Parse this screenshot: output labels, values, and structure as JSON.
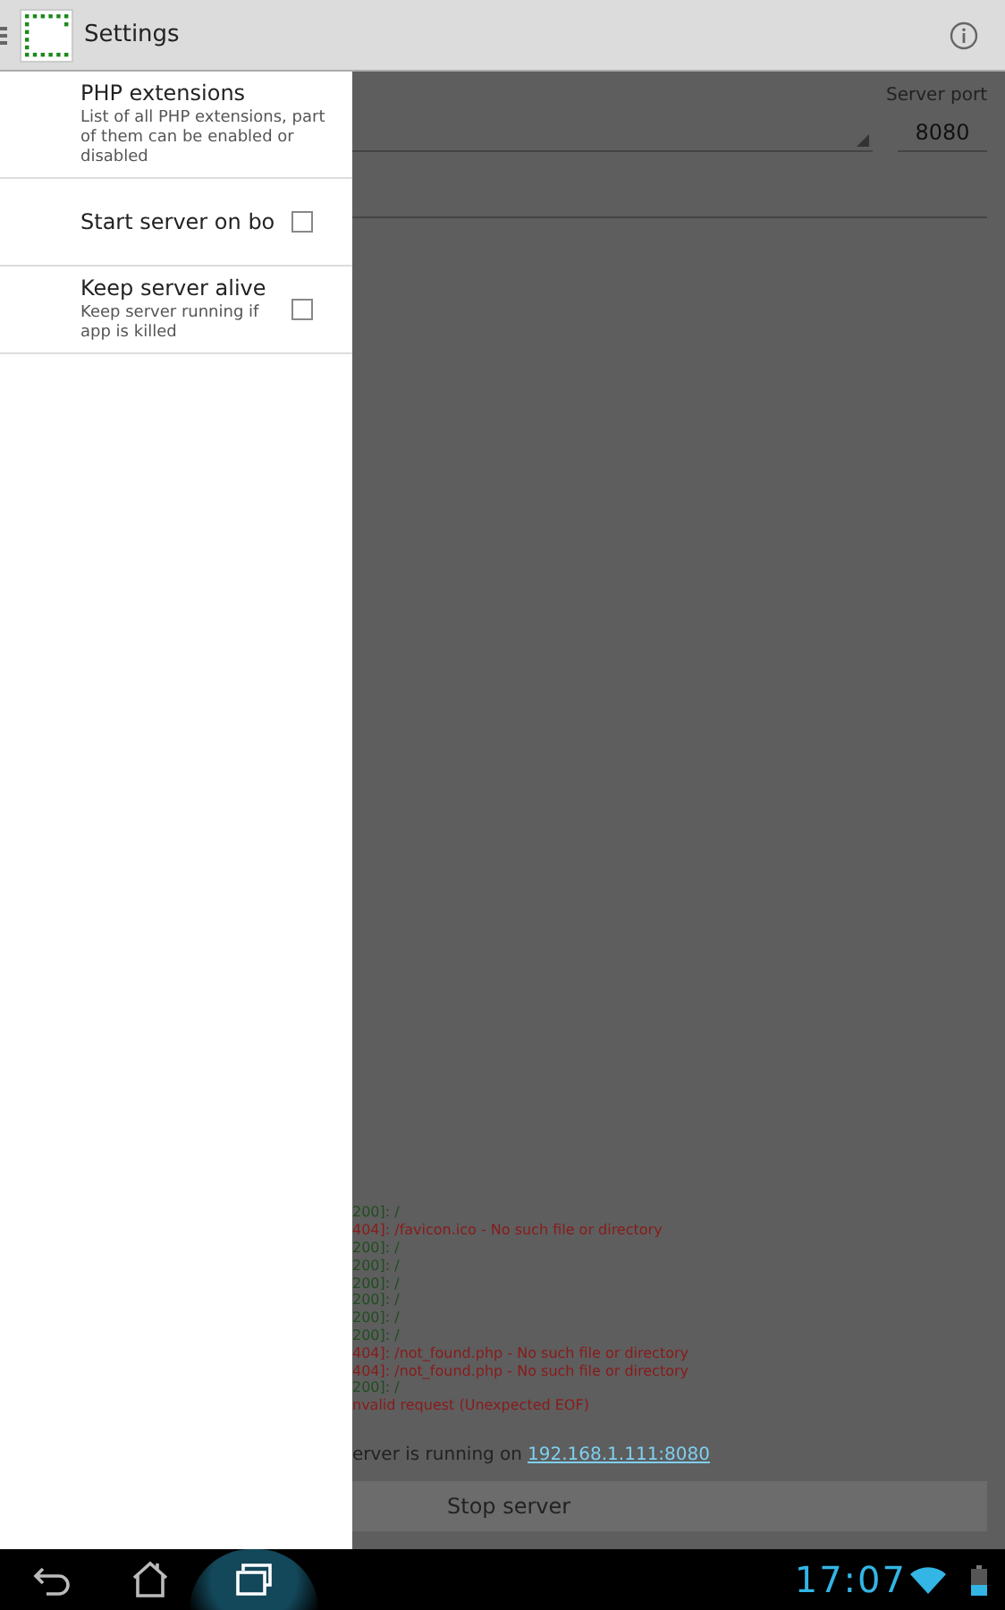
{
  "action_bar": {
    "title": "Settings"
  },
  "drawer": {
    "items": [
      {
        "kind": "link",
        "title": "PHP extensions",
        "summary": "List of all PHP extensions, part of them can be enabled or disabled"
      },
      {
        "kind": "checkbox",
        "title": "Start server on bo",
        "checked": false
      },
      {
        "kind": "checkbox",
        "title": "Keep server alive",
        "summary": "Keep server running if app is killed",
        "checked": false
      }
    ]
  },
  "main": {
    "port_label": "Server port",
    "port_value": "8080",
    "log": [
      {
        "kind": "ok",
        "text": "200]: /"
      },
      {
        "kind": "error",
        "text": "404]: /favicon.ico - No such file or directory"
      },
      {
        "kind": "ok",
        "text": "200]: /"
      },
      {
        "kind": "ok",
        "text": "200]: /"
      },
      {
        "kind": "ok",
        "text": "200]: /"
      },
      {
        "kind": "ok",
        "text": "200]: /"
      },
      {
        "kind": "ok",
        "text": "200]: /"
      },
      {
        "kind": "ok",
        "text": "200]: /"
      },
      {
        "kind": "error",
        "text": "404]: /not_found.php - No such file or directory"
      },
      {
        "kind": "error",
        "text": "404]: /not_found.php - No such file or directory"
      },
      {
        "kind": "ok",
        "text": "200]: /"
      },
      {
        "kind": "error",
        "text": "nvalid request (Unexpected EOF)"
      }
    ],
    "status_text": "erver is running on",
    "status_link": "192.168.1.111:8080",
    "button": "Stop server"
  },
  "nav_bar": {
    "time": "17:07"
  }
}
